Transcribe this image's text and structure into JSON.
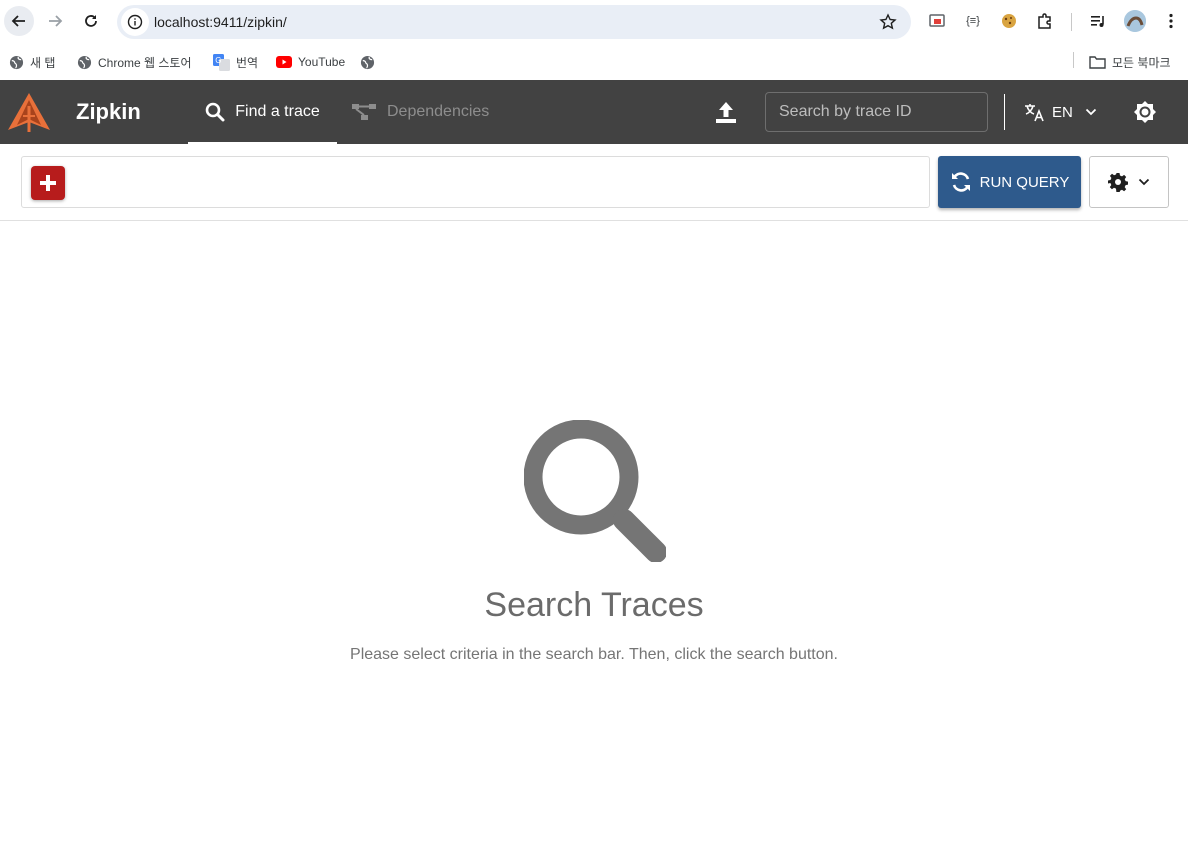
{
  "browser": {
    "url": "localhost:9411/zipkin/",
    "extensions": [
      "cast-icon",
      "json-viewer-icon",
      "cookie-icon",
      "puzzle-icon",
      "media-icon",
      "profile-avatar",
      "more-menu-icon"
    ],
    "extension_json_label": "{≡}"
  },
  "bookmarks": {
    "items": [
      {
        "label": "새 탭",
        "icon": "globe-icon"
      },
      {
        "label": "Chrome 웹 스토어",
        "icon": "globe-icon"
      },
      {
        "label": "번역",
        "icon": "google-translate-icon"
      },
      {
        "label": "YouTube",
        "icon": "youtube-icon"
      },
      {
        "label": "",
        "icon": "globe-icon"
      }
    ],
    "all_bookmarks": "모든 북마크"
  },
  "header": {
    "title": "Zipkin",
    "tabs": [
      {
        "label": "Find a trace",
        "active": true
      },
      {
        "label": "Dependencies",
        "active": false
      }
    ],
    "trace_search_placeholder": "Search by trace ID",
    "language": "EN",
    "bg_color": "#424242"
  },
  "search_bar": {
    "run_query_label": "RUN QUERY",
    "add_color": "#b71c1c",
    "run_color": "#2e5a8c"
  },
  "empty_state": {
    "title": "Search Traces",
    "description": "Please select criteria in the search bar. Then, click the search button."
  }
}
